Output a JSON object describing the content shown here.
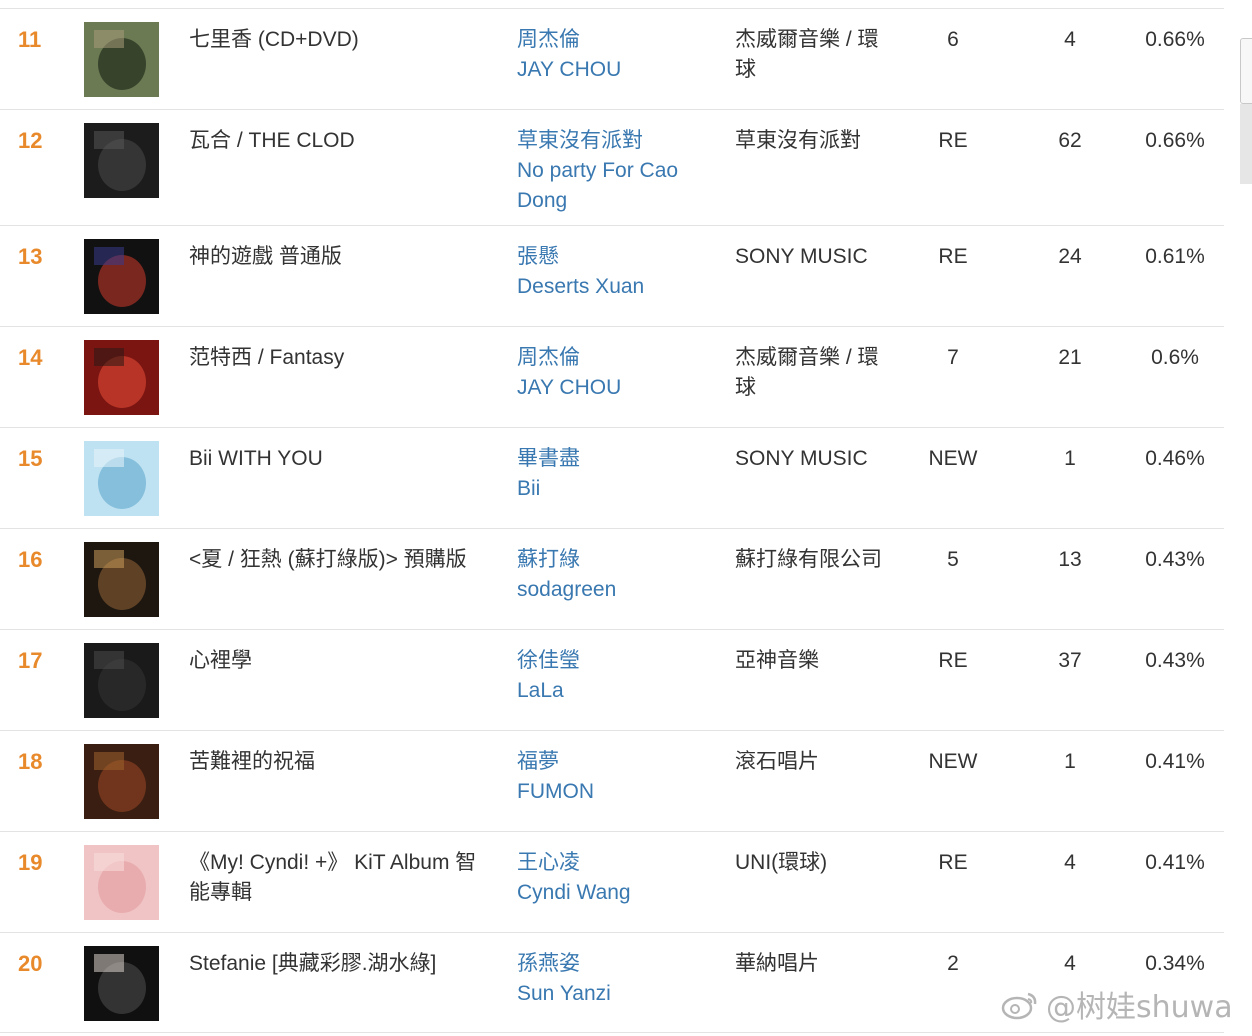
{
  "rows": [
    {
      "rank": "11",
      "album": "七里香 (CD+DVD)",
      "artist_zh": "周杰倫",
      "artist_en": "JAY CHOU",
      "label": "杰威爾音樂 / 環球",
      "last_week": "6",
      "weeks": "4",
      "share": "0.66%",
      "cover_colors": [
        "#6b7a52",
        "#2f3a26",
        "#a89a7a"
      ]
    },
    {
      "rank": "12",
      "album": "瓦合 / THE CLOD",
      "artist_zh": "草東沒有派對",
      "artist_en": "No party For Cao Dong",
      "label": "草東沒有派對",
      "last_week": "RE",
      "weeks": "62",
      "share": "0.66%",
      "cover_colors": [
        "#1c1c1c",
        "#3a3a3a",
        "#555555"
      ]
    },
    {
      "rank": "13",
      "album": "神的遊戲 普通版",
      "artist_zh": "張懸",
      "artist_en": "Deserts Xuan",
      "label": "SONY MUSIC",
      "last_week": "RE",
      "weeks": "24",
      "share": "0.61%",
      "cover_colors": [
        "#111111",
        "#8c2b22",
        "#3a3a8c"
      ]
    },
    {
      "rank": "14",
      "album": "范特西 / Fantasy",
      "artist_zh": "周杰倫",
      "artist_en": "JAY CHOU",
      "label": "杰威爾音樂 / 環球",
      "last_week": "7",
      "weeks": "21",
      "share": "0.6%",
      "cover_colors": [
        "#7a1512",
        "#c23a2a",
        "#2a1a14"
      ]
    },
    {
      "rank": "15",
      "album": "Bii WITH YOU",
      "artist_zh": "畢書盡",
      "artist_en": "Bii",
      "label": "SONY MUSIC",
      "last_week": "NEW",
      "weeks": "1",
      "share": "0.46%",
      "cover_colors": [
        "#bfe2f2",
        "#7ab8d8",
        "#e8f4fa"
      ]
    },
    {
      "rank": "16",
      "album": "<夏 / 狂熱 (蘇打綠版)> 預購版",
      "artist_zh": "蘇打綠",
      "artist_en": "sodagreen",
      "label": "蘇打綠有限公司",
      "last_week": "5",
      "weeks": "13",
      "share": "0.43%",
      "cover_colors": [
        "#1e1710",
        "#6b4a2a",
        "#c89a5a"
      ]
    },
    {
      "rank": "17",
      "album": "心裡學",
      "artist_zh": "徐佳瑩",
      "artist_en": "LaLa",
      "label": "亞神音樂",
      "last_week": "RE",
      "weeks": "37",
      "share": "0.43%",
      "cover_colors": [
        "#1a1a1a",
        "#2c2c2c",
        "#4a4a4a"
      ]
    },
    {
      "rank": "18",
      "album": "苦難裡的祝福",
      "artist_zh": "福夢",
      "artist_en": "FUMON",
      "label": "滾石唱片",
      "last_week": "NEW",
      "weeks": "1",
      "share": "0.41%",
      "cover_colors": [
        "#3a1e12",
        "#7a3a1e",
        "#a0622e"
      ]
    },
    {
      "rank": "19",
      "album": "《My! Cyndi! +》 KiT Album 智能專輯",
      "artist_zh": "王心凌",
      "artist_en": "Cyndi Wang",
      "label": "UNI(環球)",
      "last_week": "RE",
      "weeks": "4",
      "share": "0.41%",
      "cover_colors": [
        "#f0c4c4",
        "#e6a8aa",
        "#f7dede"
      ]
    },
    {
      "rank": "20",
      "album": "Stefanie [典藏彩膠.湖水綠]",
      "artist_zh": "孫燕姿",
      "artist_en": "Sun Yanzi",
      "label": "華納唱片",
      "last_week": "2",
      "weeks": "4",
      "share": "0.34%",
      "cover_colors": [
        "#101010",
        "#3a3a3a",
        "#d8d0c8"
      ]
    }
  ],
  "watermark": "@树娃shuwa"
}
